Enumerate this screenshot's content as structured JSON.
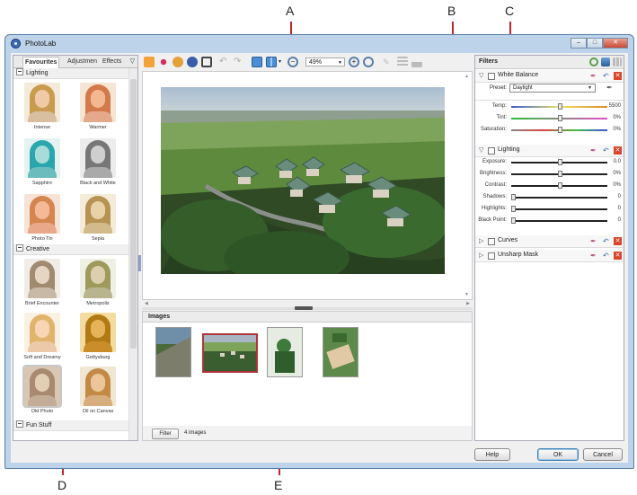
{
  "callouts": {
    "a": "A",
    "b": "B",
    "c": "C",
    "d": "D",
    "e": "E"
  },
  "window": {
    "title": "PhotoLab"
  },
  "left_panel": {
    "tabs": [
      "Favourites",
      "Adjustmen",
      "Effects"
    ],
    "categories": {
      "lighting": "Lighting",
      "creative": "Creative",
      "fun": "Fun Stuff"
    },
    "presets": [
      "Intense",
      "Warmer",
      "Sapphire",
      "Black and White",
      "Photo Tin",
      "Sepia",
      "Brief Encounter",
      "Metropolis",
      "Soft and Dreamy",
      "Gettysburg",
      "Old Photo",
      "Oil on Canvas"
    ]
  },
  "toolbar": {
    "zoom": "49%"
  },
  "images_panel": {
    "title": "Images",
    "filter_button": "Filter",
    "count": "4 images"
  },
  "filters": {
    "title": "Filters",
    "white_balance": {
      "name": "White Balance",
      "preset_label": "Preset:",
      "preset_value": "Daylight",
      "rows": [
        {
          "label": "Temp:",
          "value": "5500",
          "level": 0.5
        },
        {
          "label": "Tint:",
          "value": "0%",
          "level": 0.5
        },
        {
          "label": "Saturation:",
          "value": "0%",
          "level": 0.5
        }
      ]
    },
    "lighting": {
      "name": "Lighting",
      "rows": [
        {
          "label": "Exposure:",
          "value": "0.0",
          "level": 0.5
        },
        {
          "label": "Brightness:",
          "value": "0%",
          "level": 0.5
        },
        {
          "label": "Contrast:",
          "value": "0%",
          "level": 0.5
        },
        {
          "label": "Shadows:",
          "value": "0",
          "level": 0.0
        },
        {
          "label": "Highlights:",
          "value": "0",
          "level": 0.0
        },
        {
          "label": "Black Point:",
          "value": "0",
          "level": 0.0
        }
      ]
    },
    "curves": {
      "name": "Curves"
    },
    "unsharp": {
      "name": "Unsharp Mask"
    }
  },
  "buttons": {
    "help": "Help",
    "ok": "OK",
    "cancel": "Cancel"
  },
  "colors": {
    "accent": "#3c7fb1",
    "selection": "#b0353a",
    "callout_arrow": "#c0282a"
  }
}
